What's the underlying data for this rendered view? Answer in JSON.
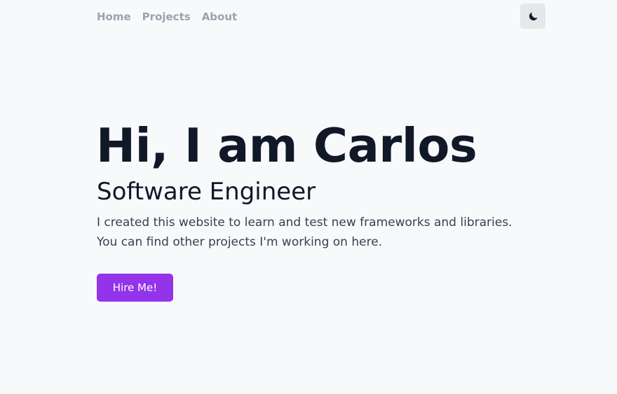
{
  "nav": {
    "items": [
      {
        "label": "Home"
      },
      {
        "label": "Projects"
      },
      {
        "label": "About"
      }
    ],
    "theme_toggle_icon": "moon-icon"
  },
  "hero": {
    "title": "Hi, I am Carlos",
    "subtitle": "Software Engineer",
    "description": "I created this website to learn and test new frameworks and libraries. You can find other projects I'm working on here.",
    "cta_label": "Hire Me!"
  },
  "colors": {
    "background": "#f8f9fb",
    "nav_text": "#9ca3af",
    "heading": "#111827",
    "body_text": "#374151",
    "accent": "#9333ea",
    "toggle_bg": "#e5e7eb"
  }
}
